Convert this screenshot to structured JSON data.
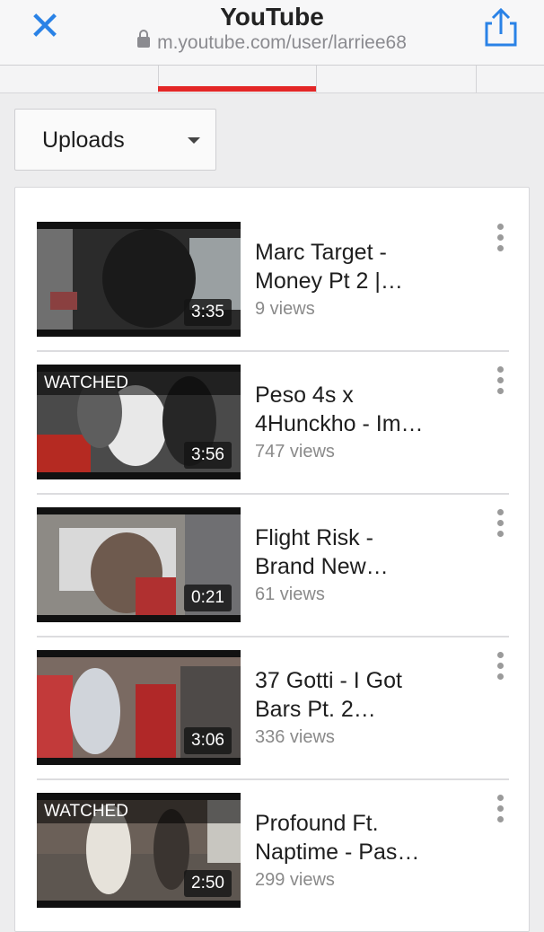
{
  "browser": {
    "title": "YouTube",
    "url": "m.youtube.com/user/larriee68"
  },
  "filter": {
    "selected": "Uploads"
  },
  "videos": [
    {
      "title_line1": "Marc Target -",
      "title_line2": "Money Pt 2 |…",
      "views": "9 views",
      "duration": "3:35",
      "watched": ""
    },
    {
      "title_line1": "Peso 4s x",
      "title_line2": "4Hunckho - Im…",
      "views": "747 views",
      "duration": "3:56",
      "watched": "WATCHED"
    },
    {
      "title_line1": "Flight Risk -",
      "title_line2": "Brand New…",
      "views": "61 views",
      "duration": "0:21",
      "watched": ""
    },
    {
      "title_line1": "37 Gotti - I Got",
      "title_line2": "Bars Pt. 2…",
      "views": "336 views",
      "duration": "3:06",
      "watched": ""
    },
    {
      "title_line1": "Profound Ft.",
      "title_line2": "Naptime - Pas…",
      "views": "299 views",
      "duration": "2:50",
      "watched": "WATCHED"
    }
  ]
}
